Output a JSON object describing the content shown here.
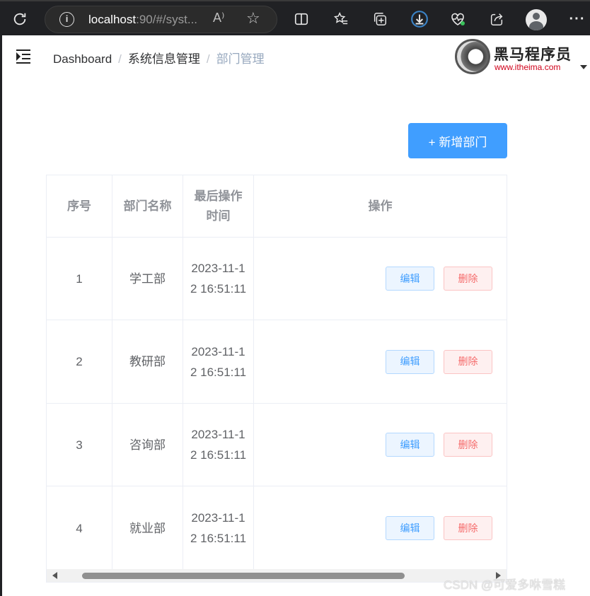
{
  "browser": {
    "url_host": "localhost",
    "url_rest": ":90/#/syst...",
    "read_aloud_glyph": "A⁾",
    "icons": [
      "refresh-icon",
      "info-icon",
      "read-aloud-icon",
      "favorite-star-icon",
      "split-screen-icon",
      "favorites-icon",
      "collections-icon",
      "download-icon",
      "health-icon",
      "share-icon",
      "profile-icon",
      "more-icon"
    ]
  },
  "header": {
    "breadcrumb": [
      "Dashboard",
      "系统信息管理",
      "部门管理"
    ],
    "breadcrumb_sep": "/",
    "logo_title": "黑马程序员",
    "logo_url": "www.itheima.com"
  },
  "toolbar": {
    "add_label": "+ 新增部门"
  },
  "table": {
    "columns": [
      "序号",
      "部门名称",
      "最后操作时间",
      "操作"
    ],
    "rows": [
      {
        "index": "1",
        "name": "学工部",
        "time": "2023-11-12 16:51:11"
      },
      {
        "index": "2",
        "name": "教研部",
        "time": "2023-11-12 16:51:11"
      },
      {
        "index": "3",
        "name": "咨询部",
        "time": "2023-11-12 16:51:11"
      },
      {
        "index": "4",
        "name": "就业部",
        "time": "2023-11-12 16:51:11"
      }
    ],
    "edit_label": "编辑",
    "delete_label": "删除"
  },
  "watermark": "CSDN @可爱多咻雪糕",
  "colors": {
    "primary": "#409eff",
    "danger": "#f56c6c",
    "browser_bg": "#202124"
  }
}
